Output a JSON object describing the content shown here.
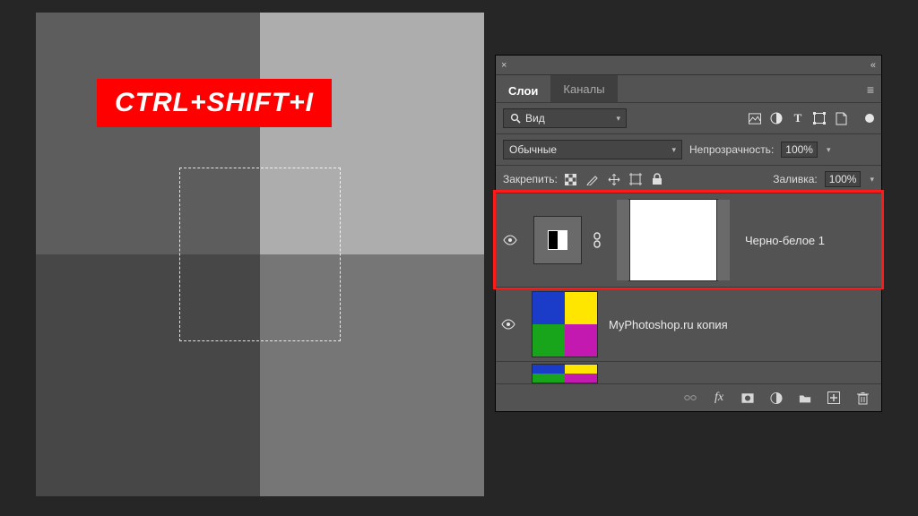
{
  "callout": "CTRL+SHIFT+I",
  "panel": {
    "tabs": {
      "active": "Слои",
      "inactive": "Каналы"
    },
    "search": {
      "label": "Вид",
      "icon": "search-icon"
    },
    "blend": {
      "mode": "Обычные",
      "opacity_label": "Непрозрачность:",
      "opacity_value": "100%"
    },
    "lock": {
      "label": "Закрепить:",
      "fill_label": "Заливка:",
      "fill_value": "100%"
    },
    "layers": [
      {
        "name": "Черно-белое 1",
        "type": "adjustment",
        "visible": true,
        "selected": true
      },
      {
        "name": "MyPhotoshop.ru копия",
        "type": "raster",
        "visible": true,
        "selected": false
      },
      {
        "name": "",
        "type": "raster-small",
        "visible": false,
        "selected": false
      }
    ]
  },
  "icons": {
    "close": "×",
    "expand": "«",
    "menu": "≡",
    "image": "image-filter-icon",
    "adjust": "adjust-filter-icon",
    "text": "T",
    "shape": "shape-filter-icon",
    "smart": "smart-filter-icon",
    "checker": "checker-icon",
    "brush": "brush-icon",
    "move": "move-icon",
    "crop": "crop-icon",
    "padlock": "lock-icon",
    "link": "∞",
    "fx": "fx",
    "mask": "mask-icon",
    "adj": "adjustment-icon",
    "folder": "folder-icon",
    "new": "new-layer-icon",
    "trash": "trash-icon",
    "eye": "◉"
  }
}
